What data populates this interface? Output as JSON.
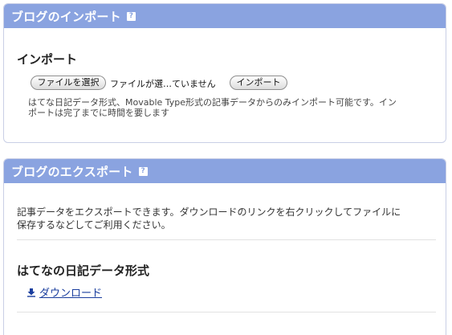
{
  "import_panel": {
    "title": "ブログのインポート",
    "help_icon": "?",
    "heading": "インポート",
    "choose_file_label": "ファイルを選択",
    "file_status": "ファイルが選…ていません",
    "import_button_label": "インポート",
    "description_line1": "はてな日記データ形式、Movable Type形式の記事データからのみインポート可能です。イン",
    "description_line2": "ポートは完了までに時間を要します"
  },
  "export_panel": {
    "title": "ブログのエクスポート",
    "help_icon": "?",
    "description_line1": "記事データをエクスポートできます。ダウンロードのリンクを右クリックしてファイルに",
    "description_line2": "保存するなどしてご利用ください。",
    "format_heading": "はてなの日記データ形式",
    "download_label": "ダウンロード"
  },
  "colors": {
    "header_bg": "#8aa3e0",
    "link": "#1a3e9e"
  },
  "icons": {
    "help": "help-icon",
    "download": "download-icon"
  }
}
